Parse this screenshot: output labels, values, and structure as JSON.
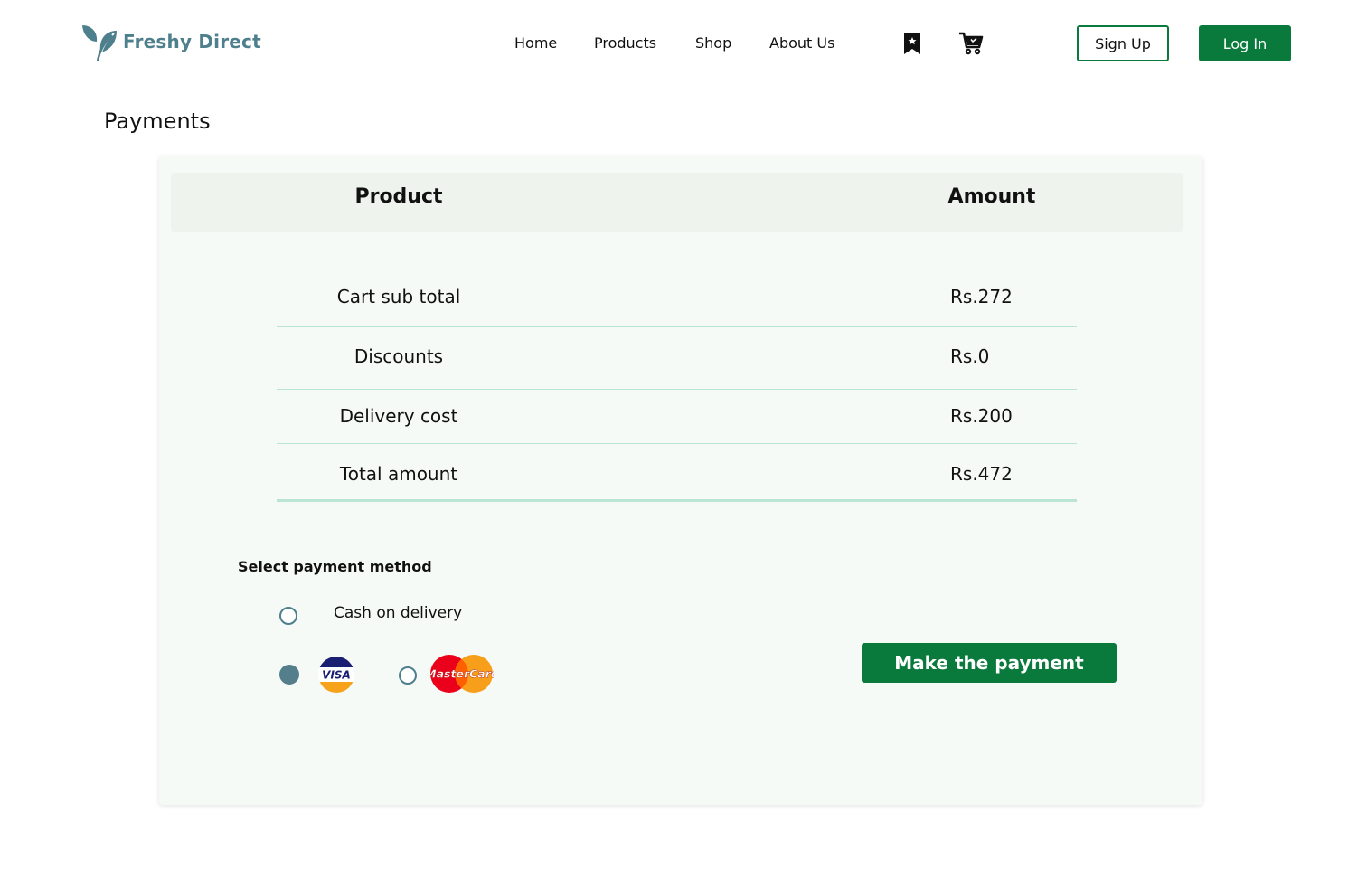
{
  "brand": {
    "name": "Freshy Direct",
    "color": "#4e7f8c"
  },
  "nav": {
    "items": [
      "Home",
      "Products",
      "Shop",
      "About Us"
    ],
    "bookmark_icon": "bookmark-icon",
    "cart_icon": "cart-icon"
  },
  "auth": {
    "signup_label": "Sign Up",
    "login_label": "Log In"
  },
  "page": {
    "title": "Payments"
  },
  "table": {
    "headers": {
      "product": "Product",
      "amount": "Amount"
    },
    "rows": [
      {
        "label": "Cart sub total",
        "value": "Rs.272"
      },
      {
        "label": "Discounts",
        "value": "Rs.0"
      },
      {
        "label": "Delivery cost",
        "value": "Rs.200"
      },
      {
        "label": "Total amount",
        "value": "Rs.472"
      }
    ]
  },
  "payment": {
    "section_label": "Select payment method",
    "cod_label": "Cash on delivery",
    "selected_method": "visa",
    "visa_text": "VISA",
    "mastercard_text": "MasterCard",
    "submit_label": "Make the payment"
  },
  "colors": {
    "accent": "#0a7a3c",
    "card_bg": "#f6faf7",
    "header_bg": "#eef3ee",
    "divider": "#b9e4d6",
    "radio": "#547e8b"
  }
}
